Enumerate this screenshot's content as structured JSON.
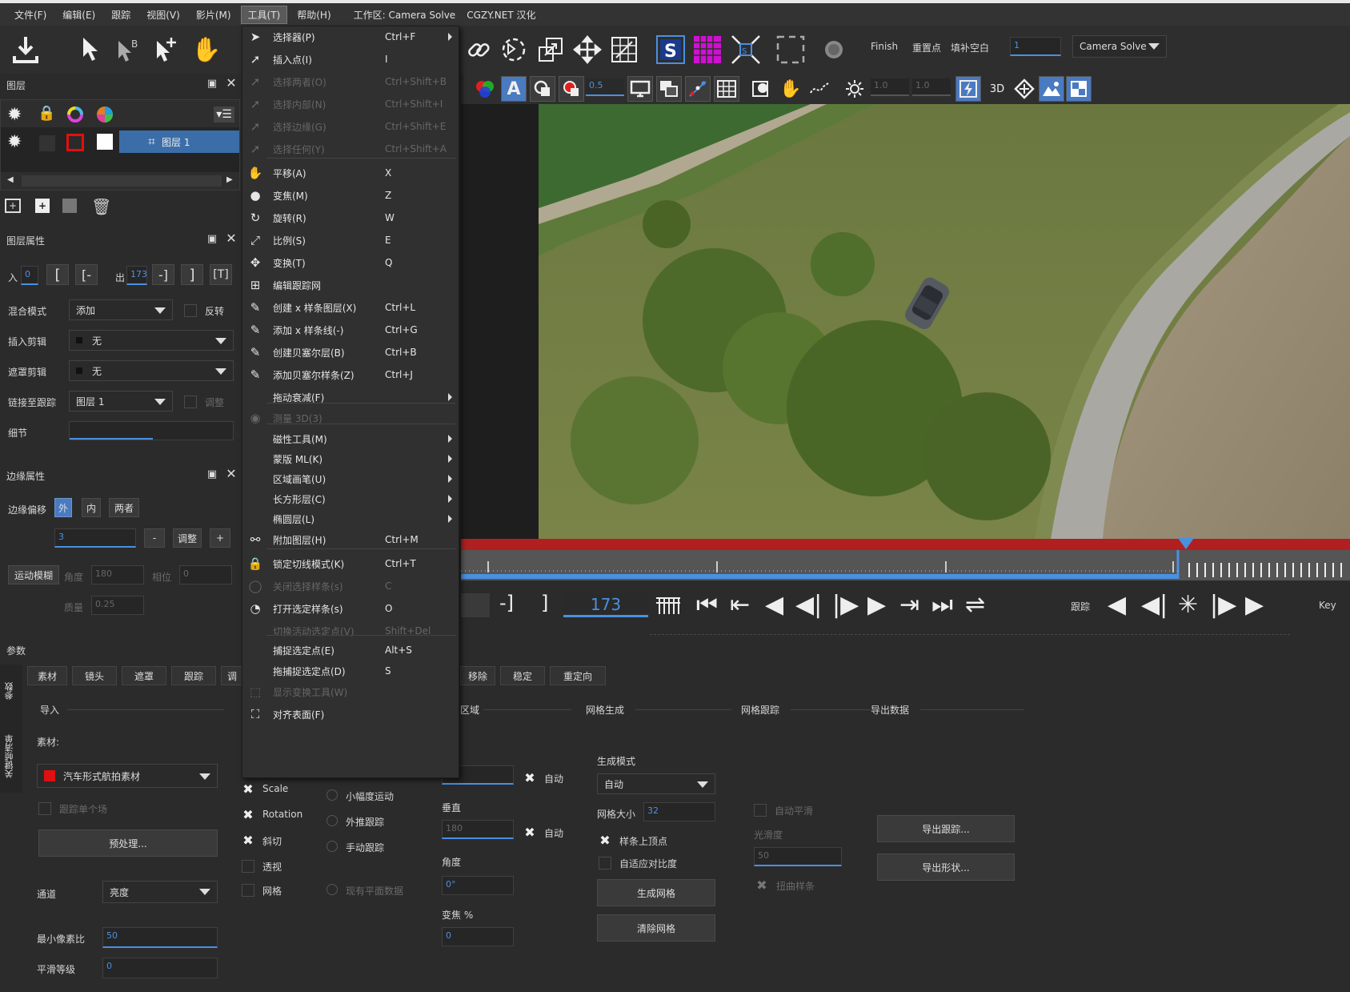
{
  "menubar": {
    "items": [
      "文件(F)",
      "编辑(E)",
      "跟踪",
      "视图(V)",
      "影片(M)",
      "工具(T)",
      "帮助(H)"
    ],
    "workspace": "工作区: Camera Solve",
    "watermark": "CGZY.NET 汉化"
  },
  "toolbar1": {
    "finish": "Finish",
    "reset_point": "重置点",
    "fill_blank": "填补空白",
    "value_field": "1",
    "preset_select": "Camera Solve"
  },
  "toolbar2": {
    "opacity": "0.5",
    "val1": "1.0",
    "val2": "1.0",
    "mode_3d": "3D"
  },
  "layers_panel": {
    "title": "图层",
    "layer_name": "图层 1"
  },
  "layer_props": {
    "title": "图层属性",
    "in_label": "入",
    "in_value": "0",
    "out_label": "出",
    "out_value": "173",
    "blend_label": "混合模式",
    "blend_value": "添加",
    "invert_label": "反转",
    "insert_clip_label": "插入剪辑",
    "insert_clip_value": "无",
    "mask_clip_label": "遮罩剪辑",
    "mask_clip_value": "无",
    "link_track_label": "链接至跟踪",
    "link_track_value": "图层 1",
    "adjust_label": "调整",
    "detail_label": "细节"
  },
  "edge_props": {
    "title": "边缘属性",
    "offset_label": "边缘偏移",
    "out_btn": "外",
    "in_btn": "内",
    "both_btn": "两者",
    "offset_value": "3",
    "minus": "-",
    "adjust": "调整",
    "plus": "+",
    "motion_blur": "运动模糊",
    "angle_label": "角度",
    "angle_value": "180",
    "phase_label": "相位",
    "phase_value": "0",
    "quality_label": "质量",
    "quality_value": "0.25"
  },
  "params": {
    "title": "参数",
    "side_tab1": "参数",
    "side_tab2": "关键帧清单",
    "tabs": [
      "素材",
      "镜头",
      "遮罩",
      "跟踪",
      "调",
      "移除",
      "稳定",
      "重定向"
    ],
    "import_section": "导入",
    "material_label": "素材:",
    "material_value": "汽车形式航拍素材",
    "track_single": "跟踪单个场",
    "preprocess": "预处理...",
    "channel_label": "通道",
    "channel_value": "亮度",
    "min_pixel_label": "最小像素比",
    "min_pixel_value": "50",
    "smooth_label": "平滑等级",
    "smooth_value": "0",
    "scale": "Scale",
    "rotation": "Rotation",
    "shear": "斜切",
    "perspective": "透视",
    "grid": "网格",
    "small_motion": "小幅度运动",
    "outward_track": "外推跟踪",
    "manual_track": "手动跟踪",
    "existing_plane": "现有平面数据",
    "region_section": "区域",
    "vertical": "垂直",
    "vertical_value": "180",
    "auto1": "自动",
    "auto2": "自动",
    "angle": "角度",
    "angle_value": "0°",
    "zoom": "变焦 %",
    "zoom_value": "0",
    "mesh_gen_section": "网格生成",
    "gen_mode_label": "生成模式",
    "gen_mode_value": "自动",
    "mesh_size_label": "网格大小",
    "mesh_size_value": "32",
    "spline_vertices": "样条上顶点",
    "adaptive_contrast": "自适应对比度",
    "gen_mesh": "生成网格",
    "clear_mesh": "清除网格",
    "mesh_track_section": "网格跟踪",
    "auto_smooth": "自动平滑",
    "smoothness": "光滑度",
    "smoothness_value": "50",
    "warp_spline": "扭曲样条",
    "export_section": "导出数据",
    "export_track": "导出跟踪...",
    "export_shape": "导出形状..."
  },
  "playback": {
    "frame": "173",
    "track_label": "跟踪",
    "key_label": "Key",
    "bracket_out": "-]",
    "bracket": "]"
  },
  "tools_menu": {
    "items": [
      {
        "icon": "arrow-select-icon",
        "label": "选择器(P)",
        "shortcut": "Ctrl+F",
        "submenu": true,
        "disabled": false
      },
      {
        "icon": "insert-point-icon",
        "label": "插入点(I)",
        "shortcut": "I",
        "submenu": false,
        "disabled": false
      },
      {
        "icon": "select-both-icon",
        "label": "选择两者(O)",
        "shortcut": "Ctrl+Shift+B",
        "submenu": false,
        "disabled": true
      },
      {
        "icon": "select-inner-icon",
        "label": "选择内部(N)",
        "shortcut": "Ctrl+Shift+I",
        "submenu": false,
        "disabled": true
      },
      {
        "icon": "select-edge-icon",
        "label": "选择边缘(G)",
        "shortcut": "Ctrl+Shift+E",
        "submenu": false,
        "disabled": true
      },
      {
        "icon": "select-any-icon",
        "label": "选择任何(Y)",
        "shortcut": "Ctrl+Shift+A",
        "submenu": false,
        "disabled": true
      },
      {
        "icon": "hand-pan-icon",
        "label": "平移(A)",
        "shortcut": "X",
        "submenu": false,
        "disabled": false
      },
      {
        "icon": "zoom-icon",
        "label": "变焦(M)",
        "shortcut": "Z",
        "submenu": false,
        "disabled": false
      },
      {
        "icon": "rotate-icon",
        "label": "旋转(R)",
        "shortcut": "W",
        "submenu": false,
        "disabled": false
      },
      {
        "icon": "scale-icon",
        "label": "比例(S)",
        "shortcut": "E",
        "submenu": false,
        "disabled": false
      },
      {
        "icon": "transform-icon",
        "label": "变换(T)",
        "shortcut": "Q",
        "submenu": false,
        "disabled": false
      },
      {
        "icon": "edit-mesh-icon",
        "label": "编辑跟踪网",
        "shortcut": "",
        "submenu": false,
        "disabled": false
      },
      {
        "icon": "x-spline-layer-icon",
        "label": "创建 x 样条图层(X)",
        "shortcut": "Ctrl+L",
        "submenu": false,
        "disabled": false
      },
      {
        "icon": "x-spline-add-icon",
        "label": "添加 x 样条线(-)",
        "shortcut": "Ctrl+G",
        "submenu": false,
        "disabled": false
      },
      {
        "icon": "bezier-layer-icon",
        "label": "创建贝塞尔层(B)",
        "shortcut": "Ctrl+B",
        "submenu": false,
        "disabled": false
      },
      {
        "icon": "bezier-add-icon",
        "label": "添加贝塞尔样条(Z)",
        "shortcut": "Ctrl+J",
        "submenu": false,
        "disabled": false
      },
      {
        "icon": "",
        "label": "拖动衰减(F)",
        "shortcut": "",
        "submenu": true,
        "disabled": false
      },
      {
        "icon": "measure-3d-icon",
        "label": "测量 3D(3)",
        "shortcut": "",
        "submenu": false,
        "disabled": true
      },
      {
        "icon": "",
        "label": "磁性工具(M)",
        "shortcut": "",
        "submenu": true,
        "disabled": false
      },
      {
        "icon": "",
        "label": "蒙版 ML(K)",
        "shortcut": "",
        "submenu": true,
        "disabled": false
      },
      {
        "icon": "",
        "label": "区域画笔(U)",
        "shortcut": "",
        "submenu": true,
        "disabled": false
      },
      {
        "icon": "",
        "label": "长方形层(C)",
        "shortcut": "",
        "submenu": true,
        "disabled": false
      },
      {
        "icon": "",
        "label": "椭圆层(L)",
        "shortcut": "",
        "submenu": true,
        "disabled": false
      },
      {
        "icon": "attach-layer-icon",
        "label": "附加图层(H)",
        "shortcut": "Ctrl+M",
        "submenu": false,
        "disabled": false
      },
      {
        "icon": "lock-icon",
        "label": "锁定切线模式(K)",
        "shortcut": "Ctrl+T",
        "submenu": false,
        "disabled": false
      },
      {
        "icon": "close-spline-icon",
        "label": "关闭选择样条(s)",
        "shortcut": "C",
        "submenu": false,
        "disabled": true
      },
      {
        "icon": "open-spline-icon",
        "label": "打开选定样条(s)",
        "shortcut": "O",
        "submenu": false,
        "disabled": false
      },
      {
        "icon": "",
        "label": "切换活动选定点(V)",
        "shortcut": "Shift+Del",
        "submenu": false,
        "disabled": true
      },
      {
        "icon": "",
        "label": "捕捉选定点(E)",
        "shortcut": "Alt+S",
        "submenu": false,
        "disabled": false
      },
      {
        "icon": "",
        "label": "拖捕捉选定点(D)",
        "shortcut": "S",
        "submenu": false,
        "disabled": false
      },
      {
        "icon": "transform-box-icon",
        "label": "显示变换工具(W)",
        "shortcut": "",
        "submenu": false,
        "disabled": true
      },
      {
        "icon": "align-surface-icon",
        "label": "对齐表面(F)",
        "shortcut": "",
        "submenu": false,
        "disabled": false
      }
    ]
  },
  "colors": {
    "accent": "#4a90e0",
    "timeline_red": "#b02020",
    "material_red": "#e01010"
  }
}
